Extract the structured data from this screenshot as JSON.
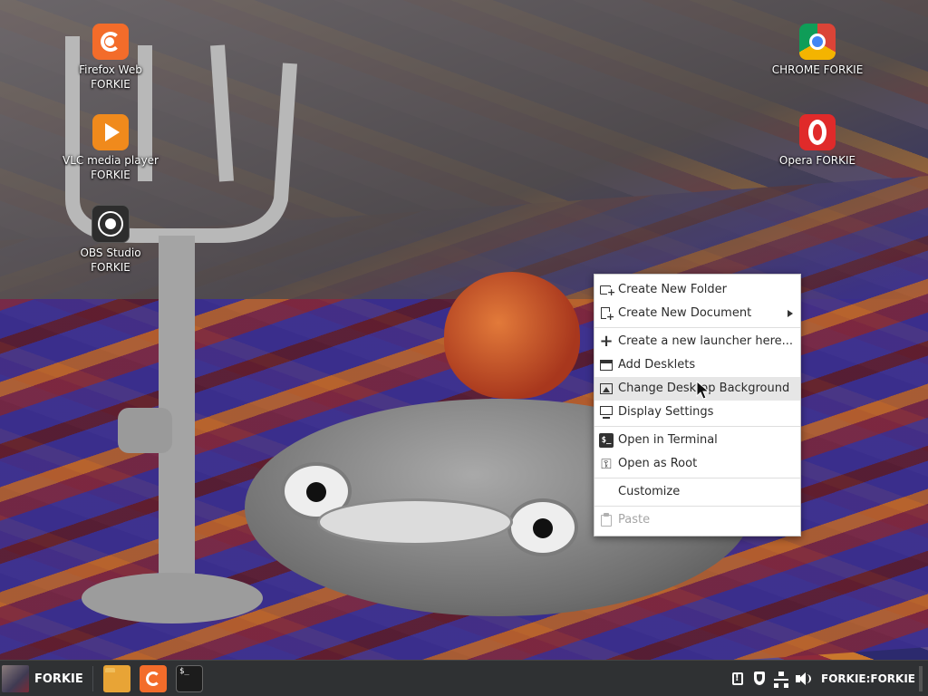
{
  "desktop": {
    "icons": [
      {
        "label": "Firefox Web\nFORKIE",
        "icon": "firefox-icon"
      },
      {
        "label": "VLC media player\nFORKIE",
        "icon": "vlc-icon"
      },
      {
        "label": "OBS Studio\nFORKIE",
        "icon": "obs-icon"
      },
      {
        "label": "CHROME FORKIE",
        "icon": "chrome-icon"
      },
      {
        "label": "Opera FORKIE",
        "icon": "opera-icon"
      }
    ]
  },
  "context_menu": {
    "items": [
      {
        "label": "Create New Folder",
        "icon": "folder-add-icon"
      },
      {
        "label": "Create New Document",
        "icon": "document-add-icon",
        "submenu": true
      },
      {
        "label": "Create a new launcher here...",
        "icon": "plus-icon"
      },
      {
        "label": "Add Desklets",
        "icon": "desklet-icon"
      },
      {
        "label": "Change Desktop Background",
        "icon": "image-icon",
        "hovered": true
      },
      {
        "label": "Display Settings",
        "icon": "display-icon"
      },
      {
        "label": "Open in Terminal",
        "icon": "terminal-icon"
      },
      {
        "label": "Open as Root",
        "icon": "key-icon"
      },
      {
        "label": "Customize",
        "icon": ""
      },
      {
        "label": "Paste",
        "icon": "paste-icon",
        "disabled": true
      }
    ],
    "terminal_glyph": "$_",
    "plus_glyph": "+",
    "key_glyph": "⚿"
  },
  "taskbar": {
    "menu_label": "FORKIE",
    "terminal_glyph": "$_",
    "user_label": "FORKIE:FORKIE"
  },
  "colors": {
    "panel": "#2f3133",
    "menu_bg": "#ffffff",
    "menu_hover": "#e6e6e6",
    "menu_disabled_text": "#a5a5a5"
  }
}
